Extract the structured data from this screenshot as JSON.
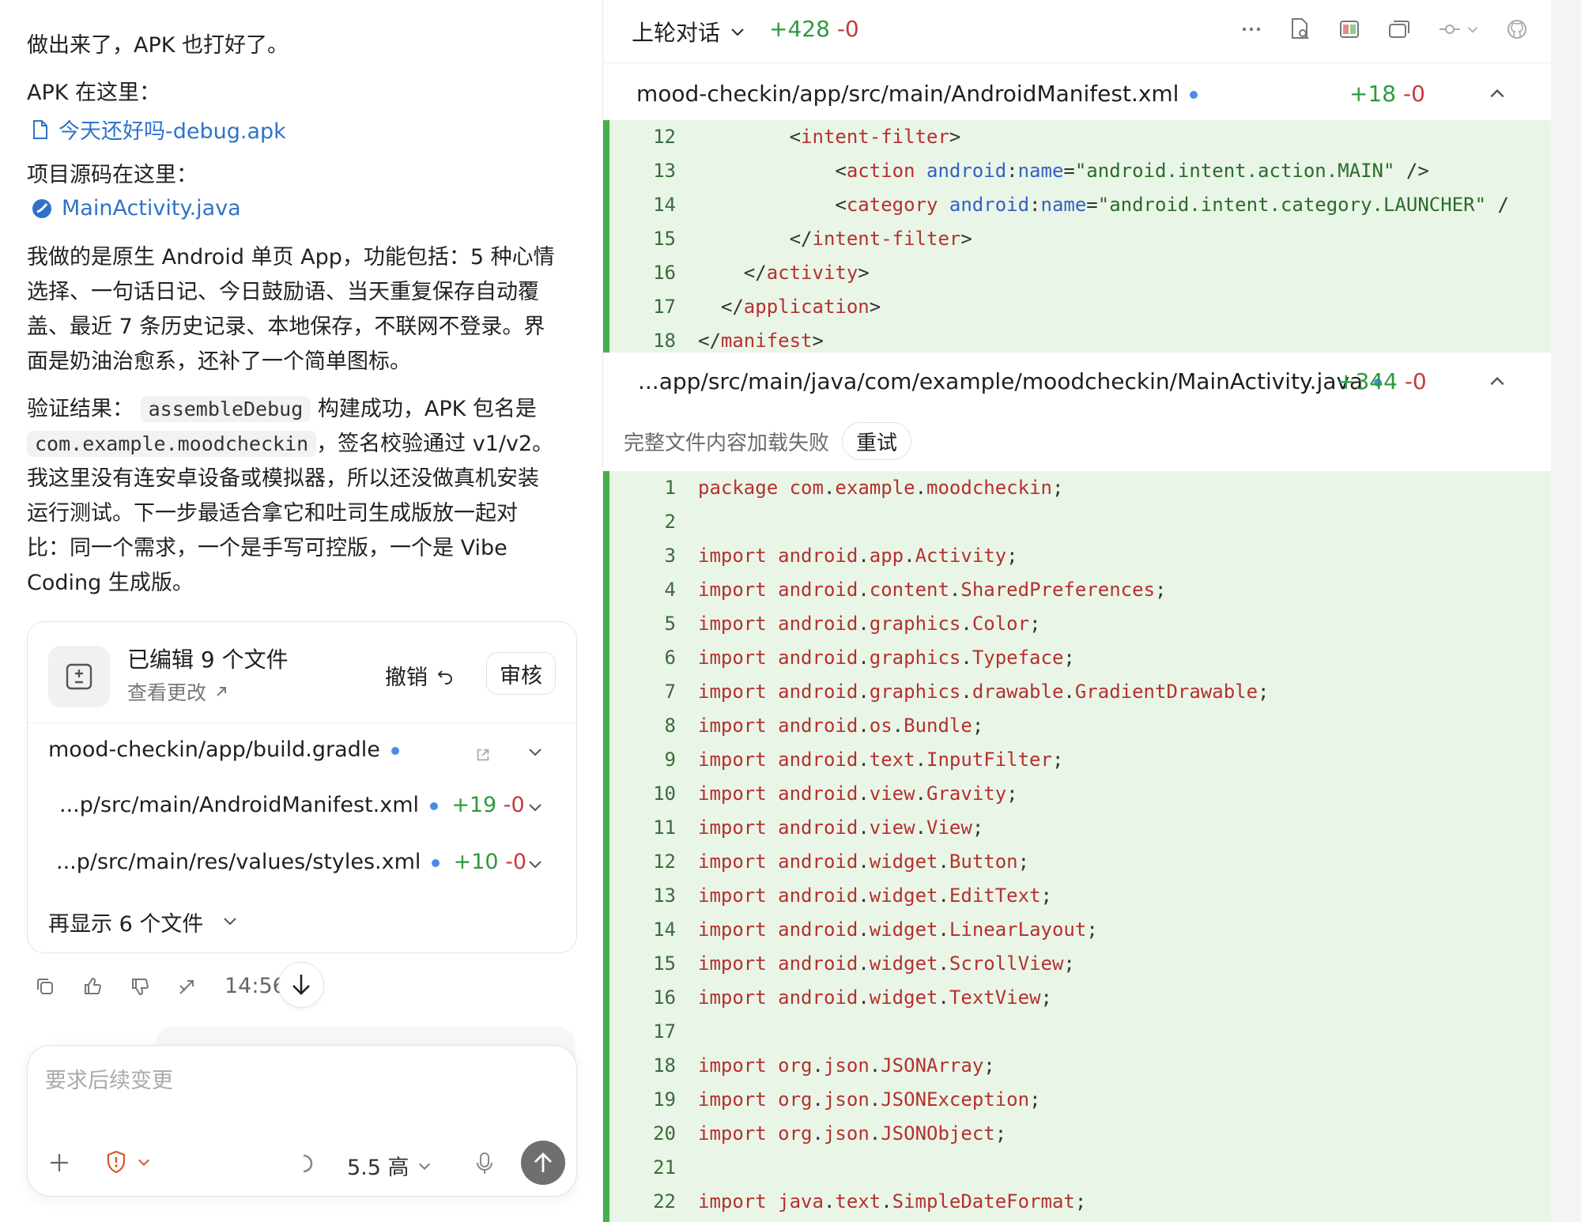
{
  "chat": {
    "p1": "做出来了，APK 也打好了。",
    "p2": "APK 在这里：",
    "apk_link": "今天还好吗-debug.apk",
    "p3": "项目源码在这里：",
    "src_link": "MainActivity.java",
    "para_lines": [
      "我做的是原生 Android 单页 App，功能包括：5 种心情",
      "选择、一句话日记、今日鼓励语、当天重复保存自动覆",
      "盖、最近 7 条历史记录、本地保存，不联网不登录。界",
      "面是奶油治愈系，还补了一个简单图标。"
    ],
    "verify": {
      "l1a": "验证结果：",
      "code1": "assembleDebug",
      "l1b": "构建成功，APK 包名是",
      "code2": "com.example.moodcheckin",
      "l2b": "，签名校验通过 v1/v2。",
      "rest": [
        "我这里没有连安卓设备或模拟器，所以还没做真机安装",
        "运行测试。下一步最适合拿它和吐司生成版放一起对",
        "比：同一个需求，一个是手写可控版，一个是 Vibe",
        "Coding 生成版。"
      ]
    }
  },
  "card": {
    "title": "已编辑 9 个文件",
    "view": "查看更改",
    "undo": "撤销",
    "review": "审核",
    "files": [
      {
        "name": "mood-checkin/app/build.gradle",
        "add": "",
        "del": ""
      },
      {
        "name": "...p/src/main/AndroidManifest.xml",
        "add": "+19",
        "del": "-0"
      },
      {
        "name": "...p/src/main/res/values/styles.xml",
        "add": "+10",
        "del": "-0"
      }
    ],
    "more": "再显示 6 个文件"
  },
  "actions": {
    "time": "14:56"
  },
  "composer": {
    "placeholder": "要求后续变更",
    "model": "5.5 高"
  },
  "diff": {
    "title": "上轮对话",
    "add": "+428",
    "del": "-0",
    "f1": {
      "path": "mood-checkin/app/src/main/AndroidManifest.xml",
      "add": "+18",
      "del": "-0"
    },
    "f2": {
      "path": "...app/src/main/java/com/example/moodcheckin/MainActivity.java",
      "add": "+344",
      "del": "-0"
    },
    "error": "完整文件内容加载失败",
    "retry": "重试",
    "xml_nums": [
      "12",
      "13",
      "14",
      "15",
      "16",
      "17",
      "18"
    ],
    "java_nums": [
      "1",
      "2",
      "3",
      "4",
      "5",
      "6",
      "7",
      "8",
      "9",
      "10",
      "11",
      "12",
      "13",
      "14",
      "15",
      "16",
      "17",
      "18",
      "19",
      "20",
      "21",
      "22"
    ],
    "java": [
      "package com.example.moodcheckin;",
      "",
      "import android.app.Activity;",
      "import android.content.SharedPreferences;",
      "import android.graphics.Color;",
      "import android.graphics.Typeface;",
      "import android.graphics.drawable.GradientDrawable;",
      "import android.os.Bundle;",
      "import android.text.InputFilter;",
      "import android.view.Gravity;",
      "import android.view.View;",
      "import android.widget.Button;",
      "import android.widget.EditText;",
      "import android.widget.LinearLayout;",
      "import android.widget.ScrollView;",
      "import android.widget.TextView;",
      "",
      "import org.json.JSONArray;",
      "import org.json.JSONException;",
      "import org.json.JSONObject;",
      "",
      "import java.text.SimpleDateFormat;"
    ],
    "xml": {
      "l12": "intent-filter",
      "l13": {
        "tag": "action",
        "ns": "android",
        "attr": "name",
        "val": "\"android.intent.action.MAIN\"",
        "end": " />"
      },
      "l14": {
        "tag": "category",
        "ns": "android",
        "attr": "name",
        "val": "\"android.intent.category.LAUNCHER\"",
        "end": " /"
      },
      "l15": "intent-filter",
      "l16": "activity",
      "l17": "application",
      "l18": "manifest"
    }
  },
  "colors": {
    "add": "#2e9a3e",
    "del": "#c73a3a",
    "link": "#2f73c9",
    "diff_bg": "#e9f6e7",
    "diff_bar": "#44b04c"
  }
}
